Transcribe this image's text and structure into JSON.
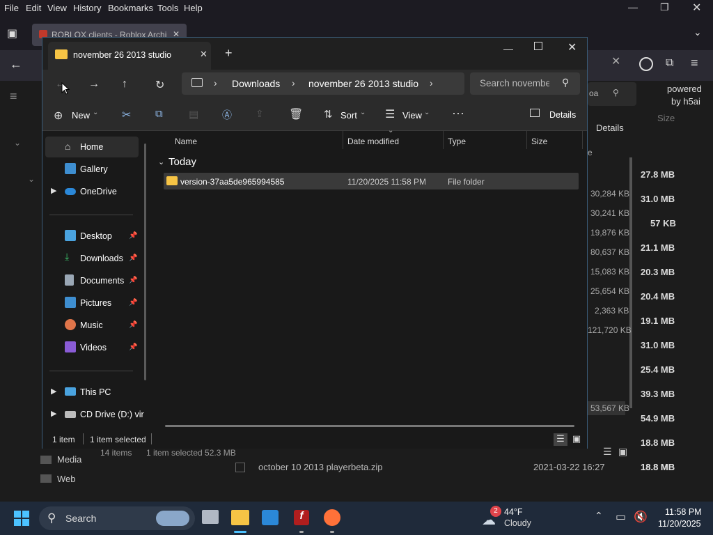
{
  "browser": {
    "menu": [
      "File",
      "Edit",
      "View",
      "History",
      "Bookmarks",
      "Tools",
      "Help"
    ],
    "tab_title": "ROBLOX clients - Roblox Archi",
    "search_partial": "oa",
    "details_label": "Details",
    "powered_by": "powered",
    "powered_by_line2": "by h5ai",
    "size_header": "Size",
    "size_col_header_partial": "e",
    "sizes": [
      "27.8 MB",
      "31.0 MB",
      "57 KB",
      "21.1 MB",
      "20.3 MB",
      "20.4 MB",
      "19.1 MB",
      "31.0 MB",
      "25.4 MB",
      "39.3 MB",
      "54.9 MB",
      "18.8 MB",
      "18.8 MB"
    ],
    "kb_values": [
      "30,284 KB",
      "30,241 KB",
      "19,876 KB",
      "80,637 KB",
      "15,083 KB",
      "25,654 KB",
      "2,363 KB",
      "121,720 KB",
      "53,567 KB"
    ],
    "folders": [
      "Media",
      "Web"
    ],
    "status": "14 items",
    "status_selected": "1 item selected  52.3 MB",
    "file_row": {
      "name": "october 10 2013 playerbeta.zip",
      "date": "2021-03-22 16:27",
      "size": "18.8 MB"
    }
  },
  "explorer": {
    "tab_title": "november 26 2013 studio",
    "breadcrumbs": [
      "Downloads",
      "november 26 2013 studio"
    ],
    "search_placeholder": "Search novembe",
    "toolbar": {
      "new": "New",
      "sort": "Sort",
      "view": "View",
      "details": "Details"
    },
    "nav": {
      "top": [
        {
          "label": "Home",
          "icon": "home-icon"
        },
        {
          "label": "Gallery",
          "icon": "gallery-icon"
        },
        {
          "label": "OneDrive",
          "icon": "onedrive-icon"
        }
      ],
      "quick": [
        {
          "label": "Desktop",
          "icon": "desktop-icon"
        },
        {
          "label": "Downloads",
          "icon": "downloads-icon"
        },
        {
          "label": "Documents",
          "icon": "documents-icon"
        },
        {
          "label": "Pictures",
          "icon": "pictures-icon"
        },
        {
          "label": "Music",
          "icon": "music-icon"
        },
        {
          "label": "Videos",
          "icon": "videos-icon"
        }
      ],
      "bottom": [
        {
          "label": "This PC",
          "icon": "this-pc-icon"
        },
        {
          "label": "CD Drive (D:) vir",
          "icon": "cd-drive-icon"
        }
      ]
    },
    "columns": [
      "Name",
      "Date modified",
      "Type",
      "Size"
    ],
    "group": "Today",
    "rows": [
      {
        "name": "version-37aa5de965994585",
        "date": "11/20/2025 11:58 PM",
        "type": "File folder",
        "size": ""
      }
    ],
    "status": {
      "count": "1 item",
      "selected": "1 item selected"
    }
  },
  "taskbar": {
    "search": "Search",
    "weather_temp": "44°F",
    "weather_desc": "Cloudy",
    "weather_badge": "2",
    "time": "11:58 PM",
    "date": "11/20/2025"
  }
}
